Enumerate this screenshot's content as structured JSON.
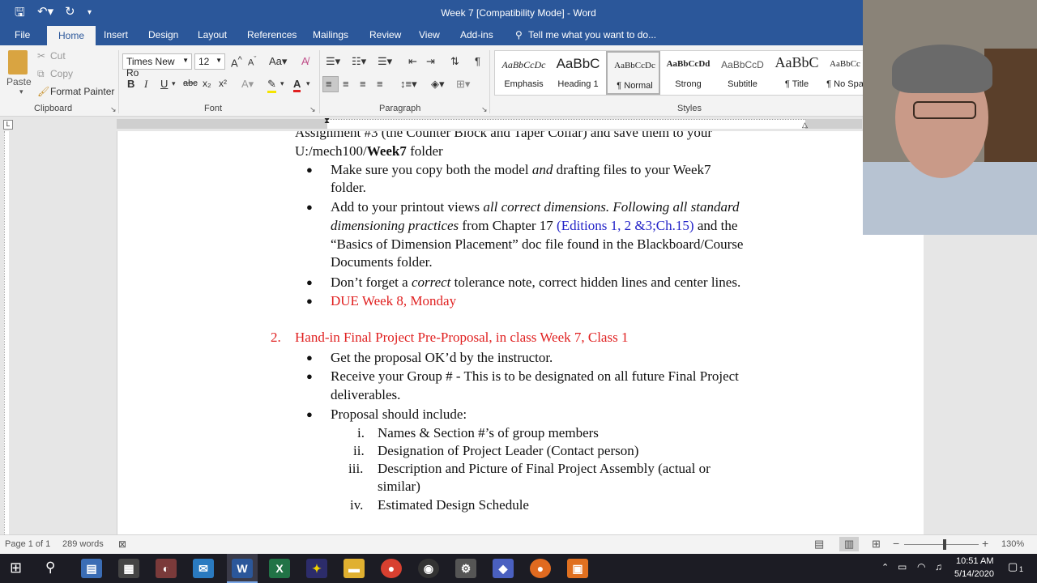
{
  "window": {
    "title": "Week 7 [Compatibility Mode] - Word"
  },
  "tabs": [
    "File",
    "Home",
    "Insert",
    "Design",
    "Layout",
    "References",
    "Mailings",
    "Review",
    "View",
    "Add-ins"
  ],
  "tell_me": "Tell me what you want to do...",
  "clipboard": {
    "paste": "Paste",
    "cut": "Cut",
    "copy": "Copy",
    "format_painter": "Format Painter",
    "label": "Clipboard"
  },
  "font": {
    "name": "Times New Ro",
    "size": "12",
    "label": "Font"
  },
  "paragraph": {
    "label": "Paragraph"
  },
  "styles": {
    "label": "Styles",
    "items": [
      {
        "preview": "AaBbCcDc",
        "name": "Emphasis"
      },
      {
        "preview": "AaBbC",
        "name": "Heading 1"
      },
      {
        "preview": "AaBbCcDc",
        "name": "¶ Normal"
      },
      {
        "preview": "AaBbCcDd",
        "name": "Strong"
      },
      {
        "preview": "AaBbCcD",
        "name": "Subtitle"
      },
      {
        "preview": "AaBbC",
        "name": "¶ Title"
      },
      {
        "preview": "AaBbCc",
        "name": "¶ No Spa"
      }
    ]
  },
  "document": {
    "line_top": "Assignment #3 (the Counter Block and Taper Collar) and save them to your",
    "line_path_prefix": "U:/mech100/",
    "line_path_bold": "Week7",
    "line_path_suffix": " folder",
    "b1_a": "Make sure you copy both the model ",
    "b1_b": "and",
    "b1_c": " drafting files to your Week7",
    "b1_d": "folder.",
    "b2_a": "Add to your printout views ",
    "b2_b": "all correct dimensions. Following all standard",
    "b2_c": "dimensioning practices",
    "b2_d": " from Chapter 17 ",
    "b2_e": "(Editions 1, 2 &3;Ch.15)",
    "b2_f": " and the",
    "b2_g": "“Basics of Dimension Placement” doc file found in the Blackboard/Course",
    "b2_h": "Documents folder.",
    "b3_a": "Don’t forget a ",
    "b3_b": "correct",
    "b3_c": " tolerance note, correct hidden lines and center lines.",
    "b4": "DUE Week 8, Monday",
    "item2_num": "2.",
    "item2": "Hand-in Final Project Pre-Proposal, in class Week 7, Class 1",
    "c1": "Get the proposal OK’d by the instructor.",
    "c2_a": "Receive your Group # - This is to be designated on all future Final Project",
    "c2_b": "deliverables.",
    "c3": "Proposal should include:",
    "r1_n": "i.",
    "r1": "Names & Section #’s of group members",
    "r2_n": "ii.",
    "r2": "Designation of Project Leader (Contact person)",
    "r3_n": "iii.",
    "r3_a": "Description and Picture of Final Project Assembly (actual or",
    "r3_b": "similar)",
    "r4_n": "iv.",
    "r4": "Estimated Design Schedule"
  },
  "status": {
    "page": "Page 1 of 1",
    "words": "289 words",
    "zoom": "130%"
  },
  "clock": {
    "time": "10:51 AM",
    "date": "5/14/2020"
  },
  "notification_count": "1"
}
